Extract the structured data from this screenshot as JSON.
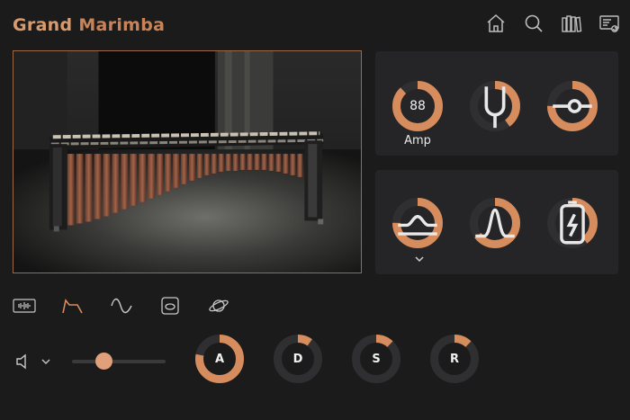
{
  "header": {
    "title_word1": "Grand",
    "title_word2": "Marimba",
    "icons": [
      "home-icon",
      "search-icon",
      "library-icon",
      "settings-icon"
    ]
  },
  "colors": {
    "accent": "#d68c5c",
    "accent_light": "#e8b48c",
    "track": "#2f2f31",
    "background": "#1b1b1c",
    "panel": "#252527"
  },
  "top_knobs": [
    {
      "name": "amp",
      "value_text": "88",
      "label": "Amp",
      "level": 0.88
    },
    {
      "name": "tune",
      "icon": "tuning-fork-icon",
      "level": 0.4
    },
    {
      "name": "pan",
      "icon": "pan-slider-icon",
      "level": 0.75
    }
  ],
  "bottom_knobs": [
    {
      "name": "filter",
      "icon": "lowpass-filter-icon",
      "level": 0.75,
      "has_dropdown": true
    },
    {
      "name": "resonance",
      "icon": "bandpass-peak-icon",
      "level": 0.65
    },
    {
      "name": "drive",
      "icon": "battery-bolt-icon",
      "level": 0.4
    }
  ],
  "modes": [
    "waveform-icon",
    "envelope-icon",
    "lfo-sine-icon",
    "effects-icon",
    "planet-icon"
  ],
  "volume": {
    "icon": "speaker-icon",
    "level": 0.34
  },
  "envelope": [
    {
      "label": "A",
      "level": 0.78
    },
    {
      "label": "D",
      "level": 0.1
    },
    {
      "label": "S",
      "level": 0.12
    },
    {
      "label": "R",
      "level": 0.12
    }
  ]
}
